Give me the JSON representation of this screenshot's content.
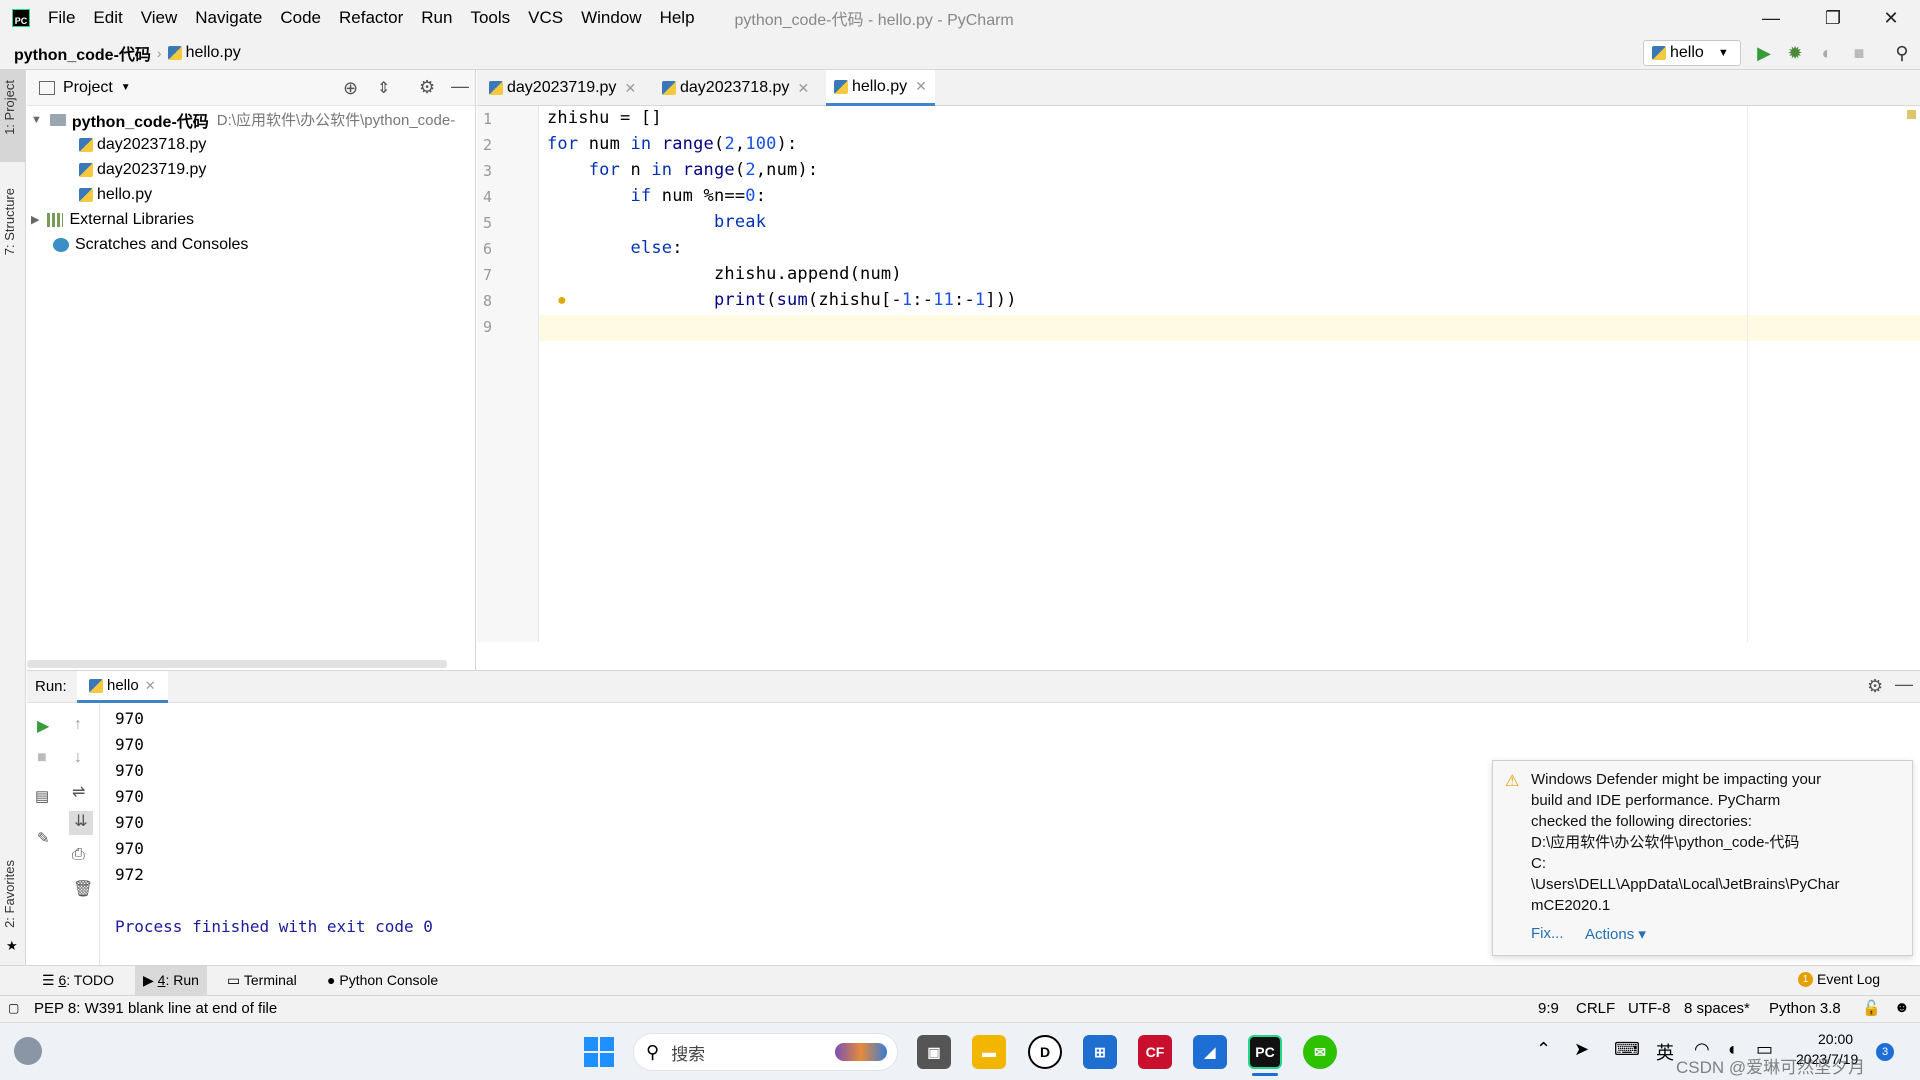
{
  "menubar": {
    "items": [
      "File",
      "Edit",
      "View",
      "Navigate",
      "Code",
      "Refactor",
      "Run",
      "Tools",
      "VCS",
      "Window",
      "Help"
    ],
    "window_title": "python_code-代码 - hello.py - PyCharm"
  },
  "navbar": {
    "project": "python_code-代码",
    "file": "hello.py",
    "run_config": "hello"
  },
  "left_stripe": {
    "project_tab": "1: Project",
    "structure_tab": "7: Structure",
    "favorites_tab": "2: Favorites"
  },
  "project_panel": {
    "title": "Project",
    "root_name": "python_code-代码",
    "root_path": "D:\\应用软件\\办公软件\\python_code-",
    "files": [
      "day2023718.py",
      "day2023719.py",
      "hello.py"
    ],
    "external_libraries": "External Libraries",
    "scratches": "Scratches and Consoles"
  },
  "editor": {
    "tabs": [
      "day2023719.py",
      "day2023718.py",
      "hello.py"
    ],
    "active_tab": "hello.py",
    "line_numbers": [
      "1",
      "2",
      "3",
      "4",
      "5",
      "6",
      "7",
      "8",
      "9"
    ]
  },
  "run_panel": {
    "label": "Run:",
    "tab": "hello",
    "output": [
      "970",
      "970",
      "970",
      "970",
      "970",
      "970",
      "972"
    ],
    "exit_message": "Process finished with exit code 0"
  },
  "notification": {
    "lines": [
      "Windows Defender might be impacting your",
      "build and IDE performance. PyCharm",
      "checked the following directories:",
      "D:\\应用软件\\办公软件\\python_code-代码",
      "C:",
      "\\Users\\DELL\\AppData\\Local\\JetBrains\\PyChar",
      "mCE2020.1"
    ],
    "fix": "Fix...",
    "actions": "Actions"
  },
  "toolstrip": {
    "todo_num": "6",
    "todo": ": TODO",
    "run_num": "4",
    "run": ": Run",
    "terminal": "Terminal",
    "python_console": "Python Console",
    "event_log_count": "1",
    "event_log": "Event Log"
  },
  "statusbar": {
    "message": "PEP 8: W391 blank line at end of file",
    "position": "9:9",
    "line_sep": "CRLF",
    "encoding": "UTF-8",
    "indent": "8 spaces*",
    "interpreter": "Python 3.8"
  },
  "taskbar": {
    "search": "搜索",
    "time": "20:00",
    "date": "2023/7/19",
    "lang": "英",
    "badge": "3",
    "watermark": "CSDN @爱琳可然坚夕月"
  }
}
